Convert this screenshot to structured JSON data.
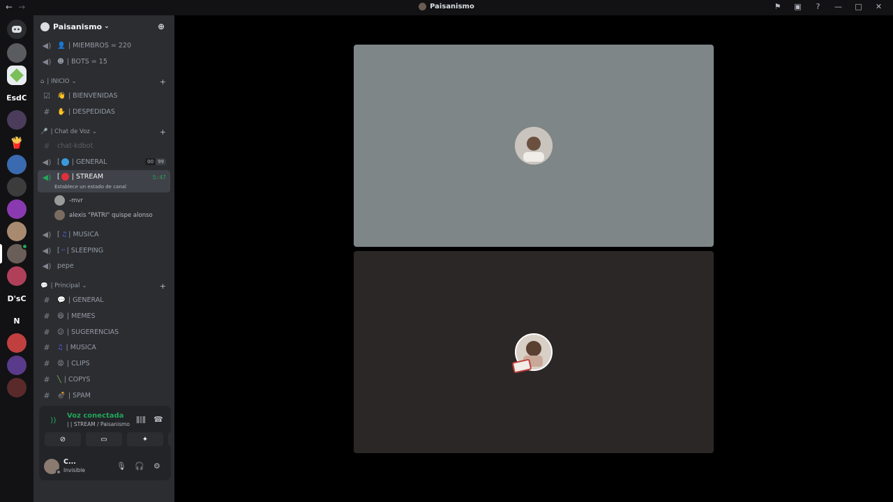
{
  "titlebar": {
    "back": "←",
    "forward": "→",
    "title": "Paisanismo"
  },
  "server": {
    "name": "Paisanismo",
    "chevron": "⌄"
  },
  "stats": [
    {
      "label": "|  MIEMBROS = 220"
    },
    {
      "label": "|  BOTS = 15"
    }
  ],
  "categories": {
    "inicio": "| INICIO",
    "voz": "| Chat de Voz",
    "principal": "| Principal"
  },
  "channels_inicio": [
    {
      "label": "|  BIENVENIDAS"
    },
    {
      "label": "|  DESPEDIDAS"
    }
  ],
  "channels_voz": {
    "kdbot": "chat-kdbot",
    "general": "| GENERAL",
    "general_count_a": "00",
    "general_count_b": "99",
    "stream": "| STREAM",
    "stream_time": "5:47",
    "stream_status": "Establece un estado de canal",
    "users": [
      "-mvr",
      "alexis \"PATRI\" quispe alonso"
    ],
    "musica": "| MUSICA",
    "sleeping": "| SLEEPING",
    "pepe": "pepe"
  },
  "channels_principal": [
    {
      "label": "|  GENERAL"
    },
    {
      "label": "|  MEMES"
    },
    {
      "label": "|  SUGERENCIAS"
    },
    {
      "label": "|  MUSICA"
    },
    {
      "label": "|  CLIPS"
    },
    {
      "label": "|  COPYS"
    },
    {
      "label": "|  SPAM"
    }
  ],
  "voice_panel": {
    "status": "Voz conectada",
    "channel": "|  | STREAM / Paisanismo"
  },
  "user": {
    "name": "C...",
    "status": "Invisible"
  },
  "servers_text": [
    "EsdC",
    "D'sC",
    "N"
  ],
  "colors": {
    "accent_green": "#23a55a",
    "tile_top": "#7f8687",
    "tile_bottom": "#2b2726"
  }
}
